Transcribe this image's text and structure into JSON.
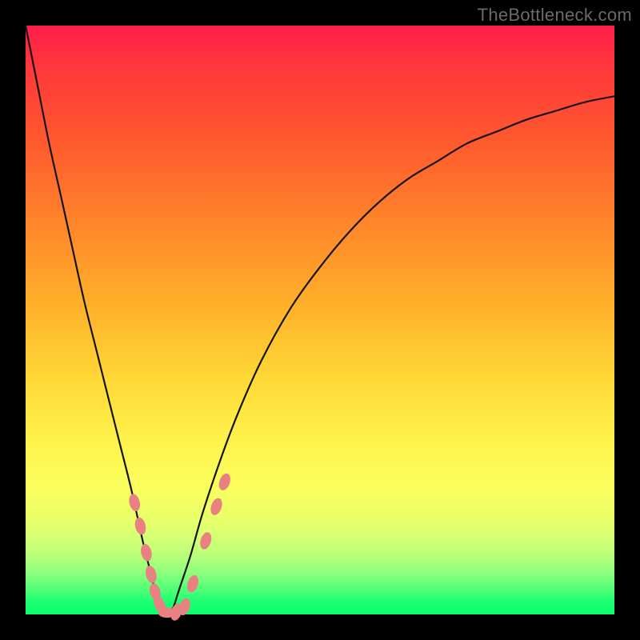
{
  "watermark": "TheBottleneck.com",
  "colors": {
    "black": "#000000",
    "curve_stroke": "#151515",
    "marker_fill": "#e98183",
    "marker_stroke": "#d46d6f"
  },
  "chart_data": {
    "type": "line",
    "title": "",
    "xlabel": "",
    "ylabel": "",
    "xlim": [
      0,
      100
    ],
    "ylim": [
      0,
      100
    ],
    "series": [
      {
        "name": "bottleneck-curve",
        "x": [
          0,
          2,
          4,
          6,
          8,
          10,
          12,
          14,
          16,
          18,
          20,
          21,
          22,
          23,
          24,
          25,
          26,
          28,
          30,
          33,
          36,
          40,
          45,
          50,
          55,
          60,
          65,
          70,
          75,
          80,
          85,
          90,
          95,
          100
        ],
        "y": [
          100,
          90,
          80,
          71,
          62,
          53,
          45,
          37,
          29,
          21,
          12,
          8,
          4,
          1,
          0,
          1,
          4,
          10,
          17,
          26,
          34,
          43,
          52,
          59,
          65,
          70,
          74,
          77,
          80,
          82,
          84,
          85.5,
          87,
          88
        ]
      }
    ],
    "markers": [
      {
        "x": 18.5,
        "y": 19
      },
      {
        "x": 19.5,
        "y": 15
      },
      {
        "x": 20.5,
        "y": 10.5
      },
      {
        "x": 21.3,
        "y": 6.8
      },
      {
        "x": 22.0,
        "y": 3.8
      },
      {
        "x": 22.8,
        "y": 1.6
      },
      {
        "x": 24.0,
        "y": 0.3
      },
      {
        "x": 25.6,
        "y": 0.4
      },
      {
        "x": 27.0,
        "y": 1.3
      },
      {
        "x": 28.4,
        "y": 5.2
      },
      {
        "x": 30.6,
        "y": 12.5
      },
      {
        "x": 32.4,
        "y": 18.3
      },
      {
        "x": 33.8,
        "y": 22.5
      }
    ]
  }
}
